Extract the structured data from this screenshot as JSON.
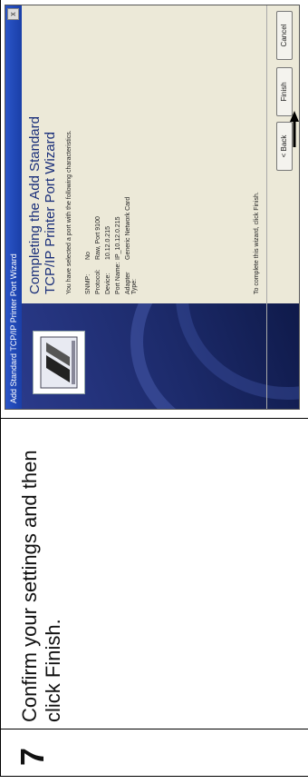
{
  "step": {
    "number": "7",
    "instruction": "Confirm your settings and then click Finish."
  },
  "wizard": {
    "window_title": "Add Standard TCP/IP Printer Port Wizard",
    "close_label": "x",
    "heading_line1": "Completing the Add Standard",
    "heading_line2": "TCP/IP Printer Port Wizard",
    "subtitle": "You have selected a port with the following characteristics.",
    "properties": [
      {
        "label": "SNMP:",
        "value": "No"
      },
      {
        "label": "Protocol:",
        "value": "Raw, Port 9100"
      },
      {
        "label": "Device:",
        "value": "10.12.0.215"
      },
      {
        "label": "Port Name:",
        "value": "IP_10.12.0.215"
      },
      {
        "label": "Adapter Type:",
        "value": "Generic Network Card"
      }
    ],
    "footer_text": "To complete this wizard, click Finish.",
    "buttons": {
      "back": "< Back",
      "finish": "Finish",
      "cancel": "Cancel"
    }
  },
  "colors": {
    "title_bar": "#2a55c8",
    "left_panel": "#1c2a6a",
    "heading": "#1a2f7a"
  }
}
